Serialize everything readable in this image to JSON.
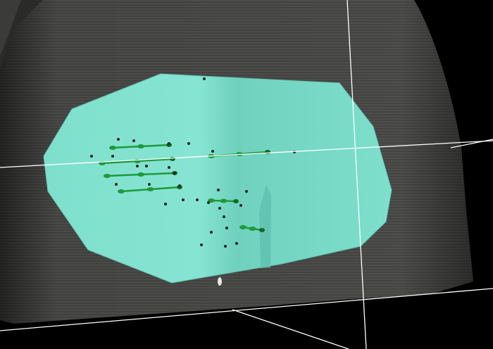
{
  "viewer": {
    "background_color": "#000000",
    "body_surface_color": "#4a4a48",
    "body_stripe_color": "#5c5c59",
    "target_volume_color": "#7ee0cc",
    "target_volume_shadow_color": "#62c4b1",
    "implant_color": "#1f9a3a",
    "implant_dark_color": "#0f6b25",
    "seed_color": "#222222",
    "crosshair_color": "#ffffff",
    "crosshair_visible": true,
    "object_names": [
      "body-surface",
      "target-volume",
      "needle-track",
      "seed-marker",
      "crosshair"
    ]
  }
}
